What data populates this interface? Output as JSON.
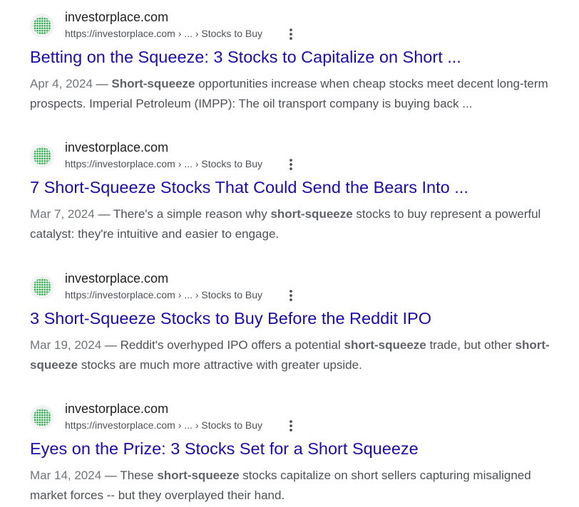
{
  "results": [
    {
      "site_name": "investorplace.com",
      "url": "https://investorplace.com",
      "breadcrumb": " › ... › Stocks to Buy",
      "title": "Betting on the Squeeze: 3 Stocks to Capitalize on Short ...",
      "date": "Apr 4, 2024",
      "dash": " — ",
      "s1": "",
      "bold1": "Short-squeeze",
      "s2": " opportunities increase when cheap stocks meet decent long-term prospects. Imperial Petroleum (IMPP): The oil transport company is buying back ...",
      "bold2": "",
      "s3": ""
    },
    {
      "site_name": "investorplace.com",
      "url": "https://investorplace.com",
      "breadcrumb": " › ... › Stocks to Buy",
      "title": "7 Short-Squeeze Stocks That Could Send the Bears Into ...",
      "date": "Mar 7, 2024",
      "dash": " — ",
      "s1": "There's a simple reason why ",
      "bold1": "short-squeeze",
      "s2": " stocks to buy represent a powerful catalyst: they're intuitive and easier to engage.",
      "bold2": "",
      "s3": ""
    },
    {
      "site_name": "investorplace.com",
      "url": "https://investorplace.com",
      "breadcrumb": " › ... › Stocks to Buy",
      "title": "3 Short-Squeeze Stocks to Buy Before the Reddit IPO",
      "date": "Mar 19, 2024",
      "dash": " — ",
      "s1": "Reddit's overhyped IPO offers a potential ",
      "bold1": "short-squeeze",
      "s2": " trade, but other ",
      "bold2": "short-squeeze",
      "s3": " stocks are much more attractive with greater upside."
    },
    {
      "site_name": "investorplace.com",
      "url": "https://investorplace.com",
      "breadcrumb": " › ... › Stocks to Buy",
      "title": "Eyes on the Prize: 3 Stocks Set for a Short Squeeze",
      "date": "Mar 14, 2024",
      "dash": " — ",
      "s1": "These ",
      "bold1": "short-squeeze",
      "s2": " stocks capitalize on short sellers capturing misaligned market forces -- but they overplayed their hand.",
      "bold2": "",
      "s3": ""
    }
  ],
  "icons": {
    "favicon": "investorplace-globe-icon",
    "menu": "more-options-icon"
  },
  "colors": {
    "title_link": "#1a0dab",
    "favicon_green": "#1ea83c"
  }
}
